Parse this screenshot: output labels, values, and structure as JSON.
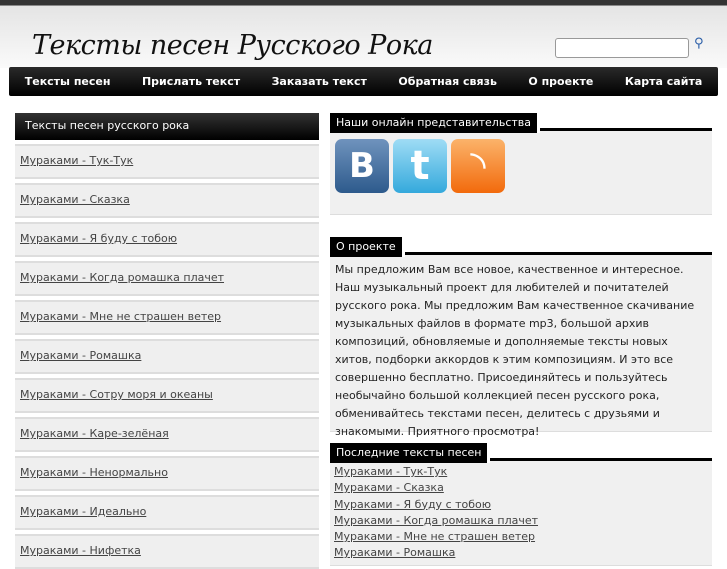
{
  "site_title": "Тексты песен Русского Рока",
  "search": {
    "placeholder": ""
  },
  "nav": [
    "Тексты песен",
    "Прислать текст",
    "Заказать текст",
    "Обратная связь",
    "О проекте",
    "Карта сайта"
  ],
  "left": {
    "title": "Тексты песен русского рока",
    "items": [
      "Мураками - Тук-Тук",
      "Мураками - Сказка",
      "Мураками - Я буду с тобою",
      "Мураками - Когда ромашка плачет",
      "Мураками - Мне не страшен ветер",
      "Мураками - Ромашка",
      "Мураками - Сотру моря и океаны",
      "Мураками - Каре-зелёная",
      "Мураками - Ненормально",
      "Мураками - Идеально",
      "Мураками - Нифетка"
    ]
  },
  "social": {
    "title": "Наши онлайн представительства",
    "icons": [
      "vk-icon",
      "twitter-icon",
      "rss-icon"
    ],
    "vk_glyph": "B",
    "tw_glyph": "t",
    "rss_glyph": "◝"
  },
  "about": {
    "title": "О проекте",
    "text": "Мы предложим Вам все новое, качественное и интересное. Наш музыкальный проект для любителей и почитателей русского рока. Мы предложим Вам качественное скачивание музыкальных файлов в формате mp3, большой архив композиций, обновляемые и дополняемые тексты новых хитов, подборки аккордов к этим композициям. И это все совершенно бесплатно. Присоединяйтесь и пользуйтесь необычайно большой коллекцией песен русского рока, обменивайтесь текстами песен, делитесь с друзьями и знакомыми. Приятного просмотра!"
  },
  "recent": {
    "title": "Последние тексты песен",
    "items": [
      "Мураками - Тук-Тук",
      "Мураками - Сказка",
      "Мураками - Я буду с тобою",
      "Мураками - Когда ромашка плачет",
      "Мураками - Мне не страшен ветер",
      "Мураками - Ромашка"
    ]
  }
}
